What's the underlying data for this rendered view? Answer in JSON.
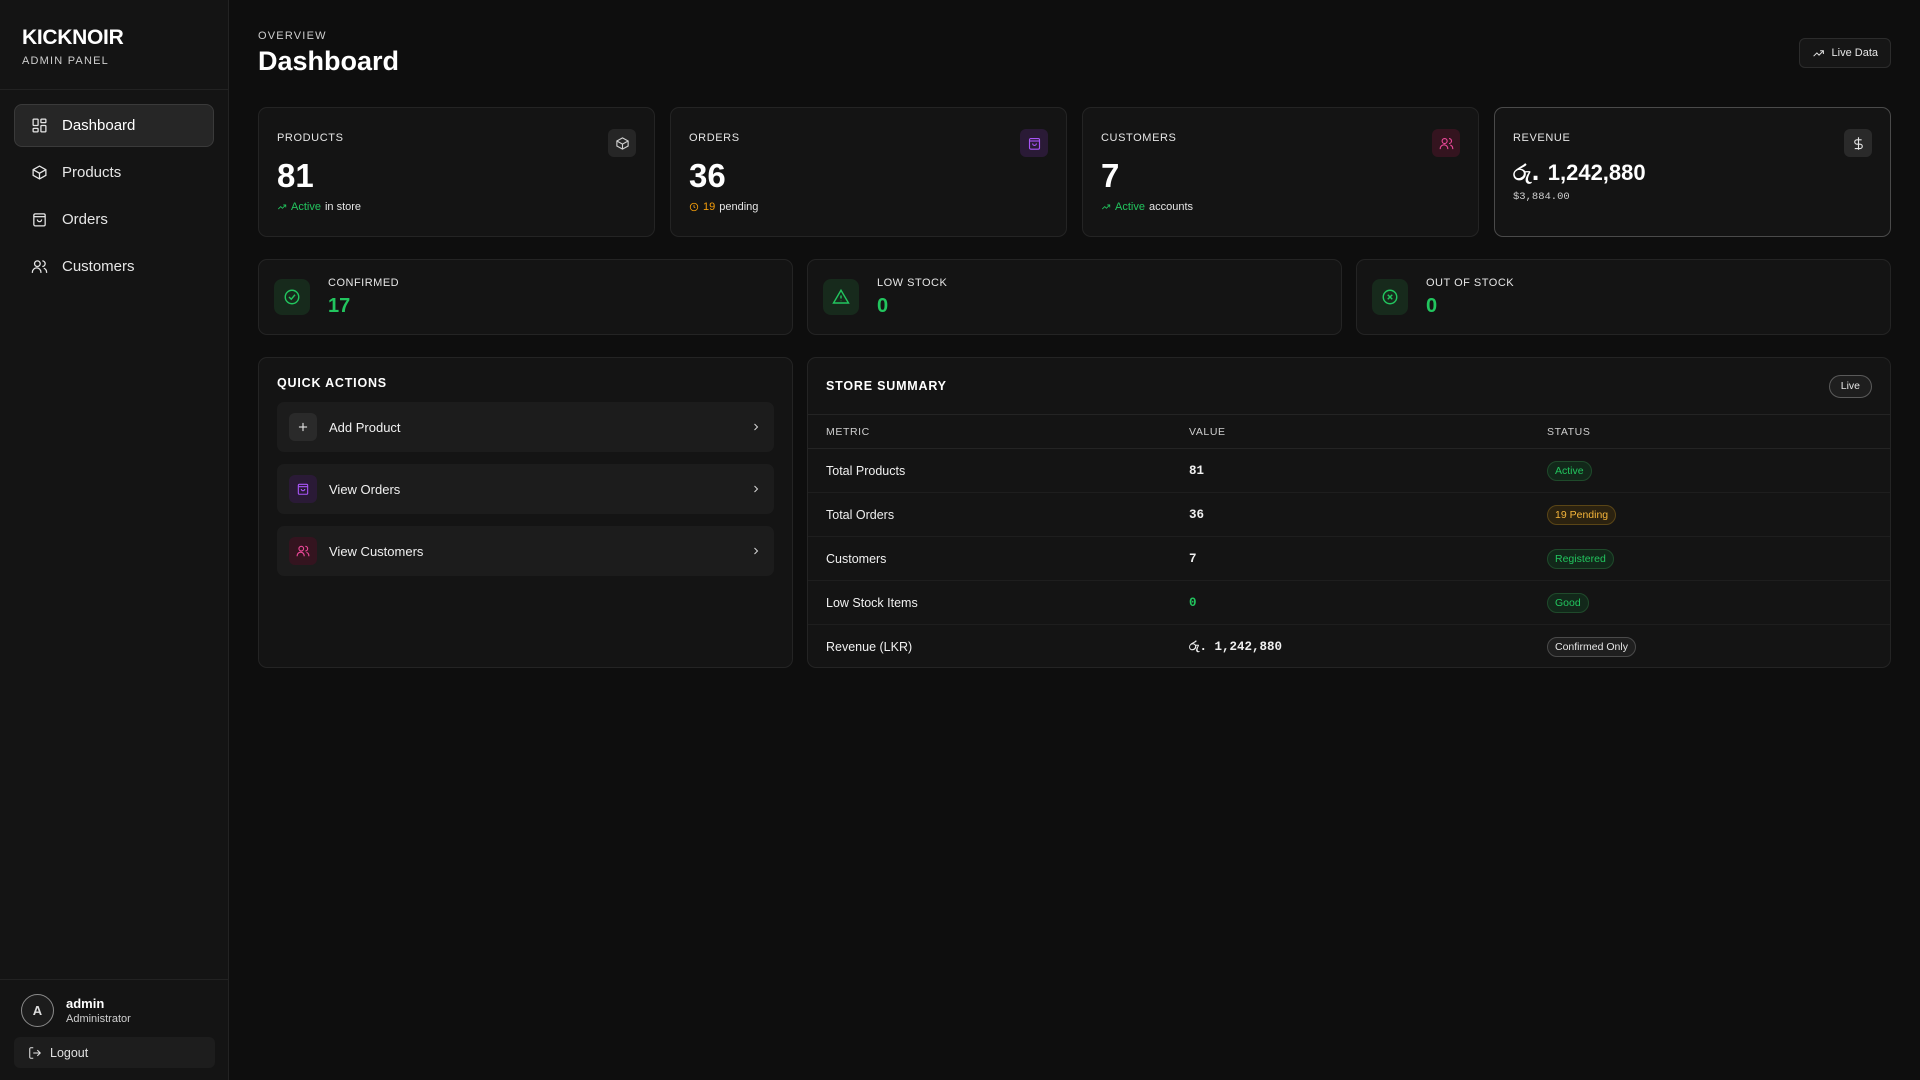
{
  "sidebar": {
    "brand_name": "KICKNOIR",
    "brand_sub": "ADMIN PANEL",
    "items": [
      {
        "label": "Dashboard",
        "icon": "grid-icon",
        "active": true
      },
      {
        "label": "Products",
        "icon": "package-icon"
      },
      {
        "label": "Orders",
        "icon": "shopping-bag-icon"
      },
      {
        "label": "Customers",
        "icon": "users-icon"
      }
    ],
    "user": {
      "initial": "A",
      "name": "admin",
      "role": "Administrator"
    },
    "logout_label": "Logout"
  },
  "header": {
    "overline": "OVERVIEW",
    "title": "Dashboard",
    "live_data_label": "Live Data"
  },
  "stats": {
    "products": {
      "label": "PRODUCTS",
      "value": "81",
      "accent": "Active",
      "sub": "in store",
      "icon": "package-icon"
    },
    "orders": {
      "label": "ORDERS",
      "value": "36",
      "accent": "19",
      "sub": "pending",
      "icon": "shopping-bag-icon"
    },
    "customers": {
      "label": "CUSTOMERS",
      "value": "7",
      "accent": "Active",
      "sub": "accounts",
      "icon": "users-icon"
    },
    "revenue": {
      "label": "REVENUE",
      "symbol": "රු.",
      "value": "1,242,880",
      "sub": "$3,884.00",
      "icon": "dollar-icon"
    }
  },
  "status_strip": {
    "confirmed": {
      "label": "CONFIRMED",
      "value": "17",
      "icon": "check-circle-icon"
    },
    "low_stock": {
      "label": "LOW STOCK",
      "value": "0",
      "icon": "alert-triangle-icon"
    },
    "out_of_stock": {
      "label": "OUT OF STOCK",
      "value": "0",
      "icon": "x-circle-icon"
    }
  },
  "quick_actions": {
    "title": "QUICK ACTIONS",
    "items": [
      {
        "label": "Add Product",
        "icon": "plus-icon"
      },
      {
        "label": "View Orders",
        "icon": "shopping-bag-icon"
      },
      {
        "label": "View Customers",
        "icon": "users-icon"
      }
    ]
  },
  "store_summary": {
    "title": "STORE SUMMARY",
    "live_label": "Live",
    "columns": [
      "METRIC",
      "VALUE",
      "STATUS"
    ],
    "rows": [
      {
        "metric": "Total Products",
        "value": "81",
        "status": "Active"
      },
      {
        "metric": "Total Orders",
        "value": "36",
        "status": "19 Pending"
      },
      {
        "metric": "Customers",
        "value": "7",
        "status": "Registered"
      },
      {
        "metric": "Low Stock Items",
        "value": "0",
        "status": "Good"
      },
      {
        "metric": "Revenue (LKR)",
        "value": "රු. 1,242,880",
        "status": "Confirmed Only"
      }
    ]
  },
  "colors": {
    "accent_green": "#22c55e",
    "accent_amber": "#f59e0b",
    "accent_purple": "#a855f7",
    "accent_pink": "#ec4899",
    "background": "#0e0e0e"
  }
}
